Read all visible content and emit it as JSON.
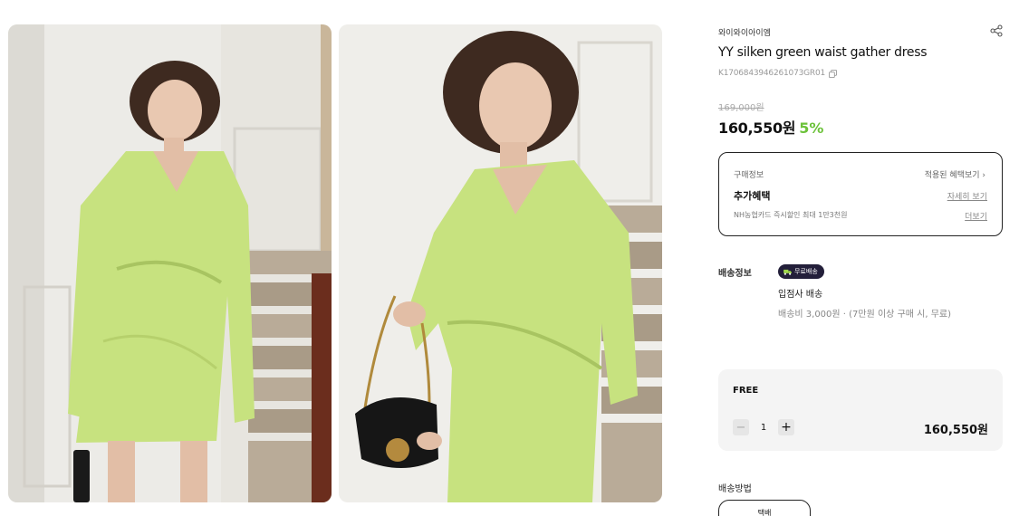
{
  "product": {
    "brand": "와이와이아이엠",
    "title": "YY silken green waist gather dress",
    "code": "K1706843946261073GR01",
    "original_price": "169,000원",
    "sale_price": "160,550원",
    "discount": "5%"
  },
  "benefits": {
    "label": "구매정보",
    "applied_link": "적용된 혜택보기 ›",
    "title": "추가혜택",
    "detail_link": "자세히 보기",
    "card_text": "NH농협카드 즉시할인 최대 1만3천원",
    "more_link": "더보기"
  },
  "shipping": {
    "label": "배송정보",
    "badge": "무료배송",
    "vendor": "입점사 배송",
    "fee": "배송비 3,000원 · (7만원 이상 구매 시, 무료)"
  },
  "option": {
    "name": "FREE",
    "quantity": "1",
    "price": "160,550원"
  },
  "delivery": {
    "label": "배송방법",
    "method": "택배"
  },
  "icons": [
    "share-icon",
    "copy-icon",
    "truck-icon",
    "minus-icon",
    "plus-icon"
  ],
  "colors": {
    "accent_discount": "#6cc23a",
    "badge_bg": "#231f3a",
    "option_bg": "#f4f4f4",
    "dress": "#c7e27f"
  }
}
